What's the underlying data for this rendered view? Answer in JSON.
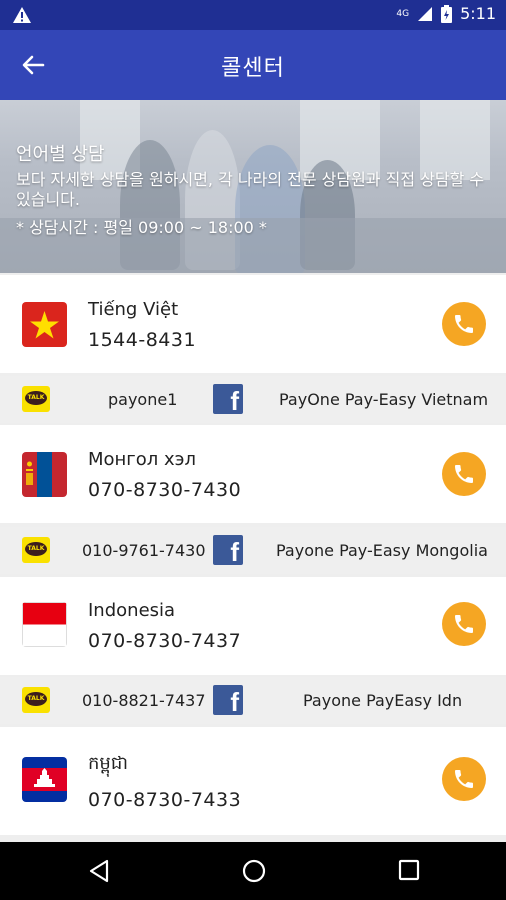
{
  "status_bar": {
    "network": "4G",
    "time": "5:11"
  },
  "app_bar": {
    "title": "콜센터"
  },
  "banner": {
    "heading": "언어별 상담",
    "description": "보다 자세한 상담을 원하시면, 각 나라의 전문 상담원과 직접 상담할 수 있습니다.",
    "hours": "* 상담시간 : 평일 09:00 ~ 18:00 *"
  },
  "centers": [
    {
      "language": "Tiếng Việt",
      "phone": "1544-8431",
      "kakao_id": "payone1",
      "facebook": "PayOne Pay-Easy Vietnam"
    },
    {
      "language": "Монгол хэл",
      "phone": "070-8730-7430",
      "kakao_id": "010-9761-7430",
      "facebook": "Payone Pay-Easy Mongolia"
    },
    {
      "language": "Indonesia",
      "phone": "070-8730-7437",
      "kakao_id": "010-8821-7437",
      "facebook": "Payone PayEasy Idn"
    },
    {
      "language": "កម្ពុជា",
      "phone": "070-8730-7433"
    }
  ],
  "kakao_badge": "TALK",
  "facebook_badge": "f",
  "colors": {
    "status_bar": "#1f2f93",
    "app_bar": "#3346b7",
    "call_button": "#f5a623",
    "kakao": "#fae100",
    "facebook": "#3b5998"
  }
}
